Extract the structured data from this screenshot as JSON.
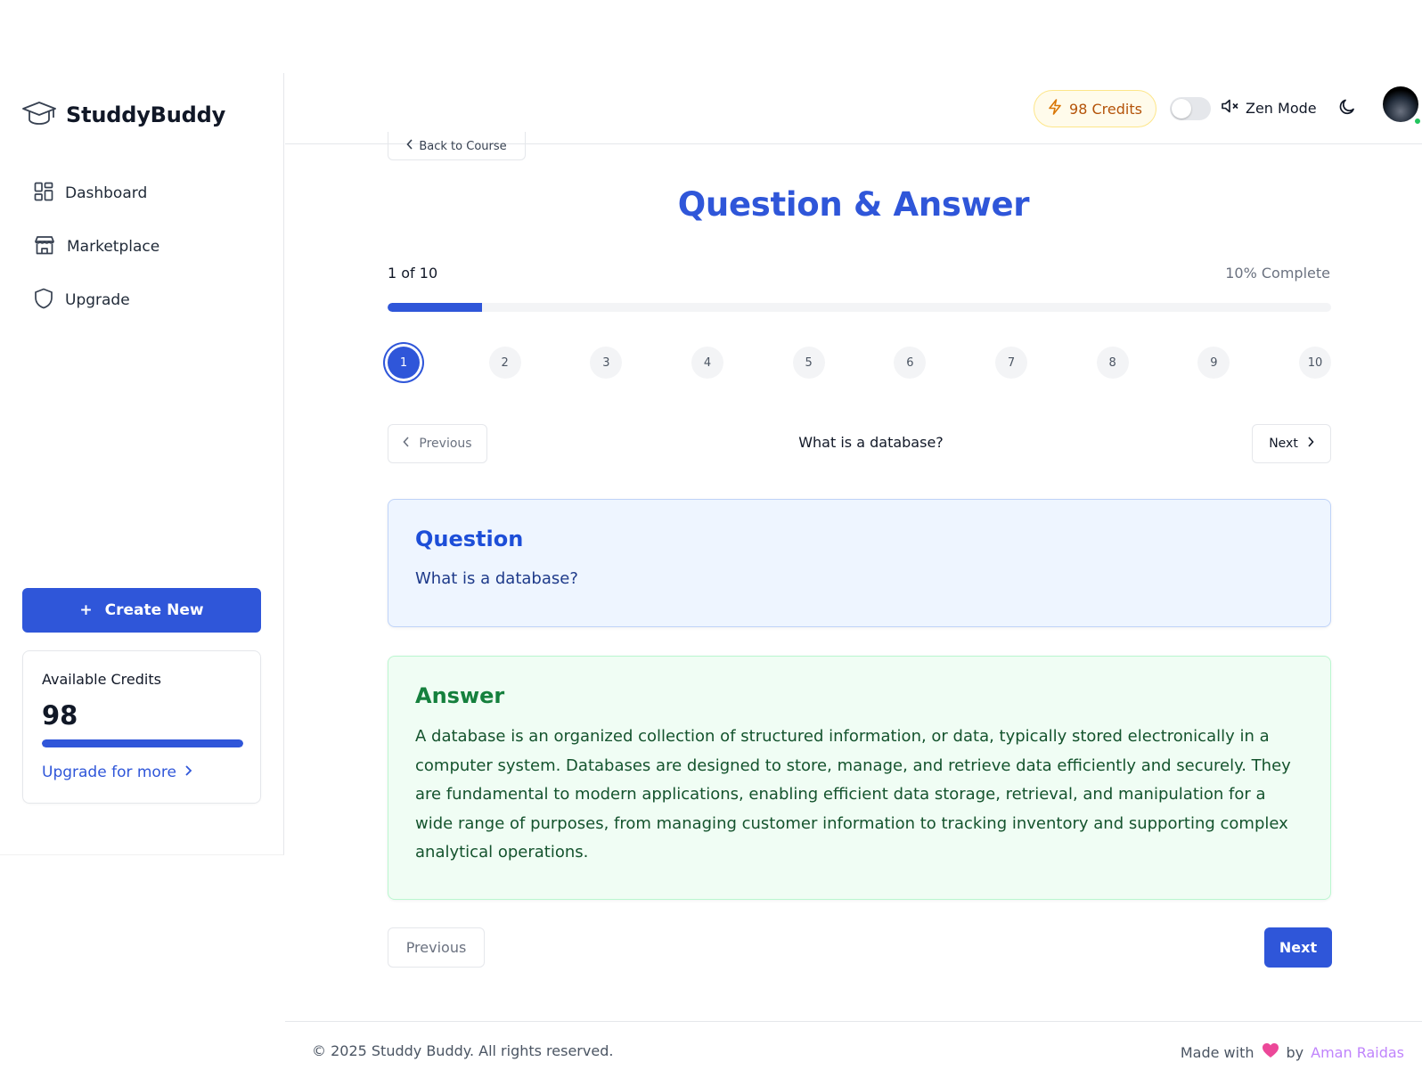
{
  "brand": {
    "name": "StuddyBuddy",
    "icon": "graduation-cap-icon"
  },
  "sidebar": {
    "items": [
      {
        "label": "Dashboard",
        "icon": "grid-icon"
      },
      {
        "label": "Marketplace",
        "icon": "store-icon"
      },
      {
        "label": "Upgrade",
        "icon": "shield-icon"
      }
    ],
    "create_new": {
      "icon_text": "+",
      "label": "Create New"
    },
    "credits_card": {
      "label": "Available Credits",
      "value": "98",
      "fill_fraction": 1.0,
      "upgrade_label": "Upgrade for more"
    }
  },
  "header": {
    "credits_label": "98 Credits",
    "zen_mode": {
      "label": "Zen Mode",
      "enabled": false
    },
    "theme_icon": "moon-icon",
    "avatar_online": true
  },
  "main": {
    "back_label": "Back to Course",
    "title": "Question & Answer",
    "progress": {
      "position_label": "1 of 10",
      "percent_label": "10% Complete",
      "fraction": 0.1
    },
    "steps": [
      "1",
      "2",
      "3",
      "4",
      "5",
      "6",
      "7",
      "8",
      "9",
      "10"
    ],
    "active_step": 1,
    "nav": {
      "previous": "Previous",
      "next": "Next",
      "current_question": "What is a database?"
    },
    "question_card": {
      "title": "Question",
      "text": "What is a database?"
    },
    "answer_card": {
      "title": "Answer",
      "text": "A database is an organized collection of structured information, or data, typically stored electronically in a computer system. Databases are designed to store, manage, and retrieve data efficiently and securely. They are fundamental to modern applications, enabling efficient data storage, retrieval, and manipulation for a wide range of purposes, from managing customer information to tracking inventory and supporting complex analytical operations."
    },
    "bottom_nav": {
      "previous": "Previous",
      "next": "Next"
    }
  },
  "footer": {
    "copyright": "© 2025 Studdy Buddy. All rights reserved.",
    "made_with": "Made with",
    "by": "by",
    "author": "Aman Raidas",
    "heart_color": "#ec4899"
  },
  "colors": {
    "primary": "#2f56d9",
    "question_bg": "#eef5ff",
    "answer_bg": "#f0fdf4",
    "credits_accent": "#b45309"
  }
}
